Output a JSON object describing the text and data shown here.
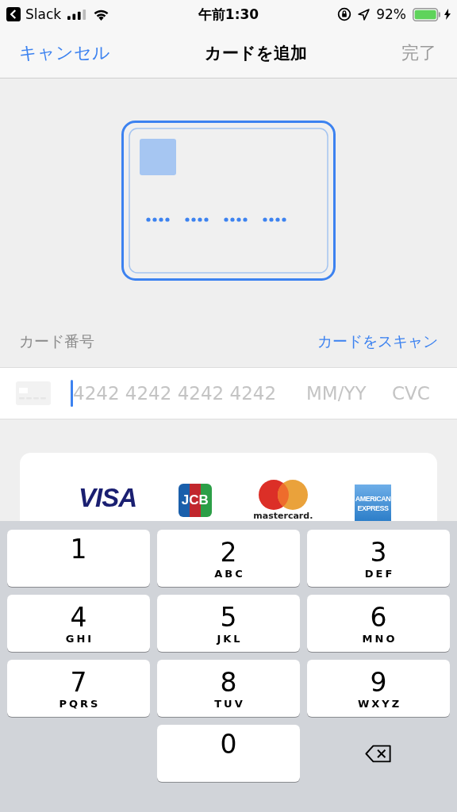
{
  "status_bar": {
    "back_app": "Slack",
    "time": "午前1:30",
    "battery": "92%"
  },
  "nav": {
    "cancel": "キャンセル",
    "title": "カードを追加",
    "done": "完了",
    "done_disabled": true
  },
  "card_field": {
    "label": "カード番号",
    "scan": "カードをスキャン",
    "number_placeholder": "4242 4242 4242 4242",
    "expiry_placeholder": "MM/YY",
    "cvc_placeholder": "CVC"
  },
  "brands": [
    {
      "kind": "visa",
      "text": "VISA"
    },
    {
      "kind": "jcb",
      "text": "JCB"
    },
    {
      "kind": "mastercard",
      "text": "mastercard."
    },
    {
      "kind": "amex",
      "text": "AMERICAN EXPRESS"
    }
  ],
  "keypad": [
    {
      "kind": "digit",
      "digit": "1"
    },
    {
      "kind": "digit",
      "digit": "2",
      "letters": "ABC"
    },
    {
      "kind": "digit",
      "digit": "3",
      "letters": "DEF"
    },
    {
      "kind": "digit",
      "digit": "4",
      "letters": "GHI"
    },
    {
      "kind": "digit",
      "digit": "5",
      "letters": "JKL"
    },
    {
      "kind": "digit",
      "digit": "6",
      "letters": "MNO"
    },
    {
      "kind": "digit",
      "digit": "7",
      "letters": "PQRS"
    },
    {
      "kind": "digit",
      "digit": "8",
      "letters": "TUV"
    },
    {
      "kind": "digit",
      "digit": "9",
      "letters": "WXYZ"
    },
    {
      "kind": "blank"
    },
    {
      "kind": "digit",
      "digit": "0"
    },
    {
      "kind": "delete"
    }
  ]
}
